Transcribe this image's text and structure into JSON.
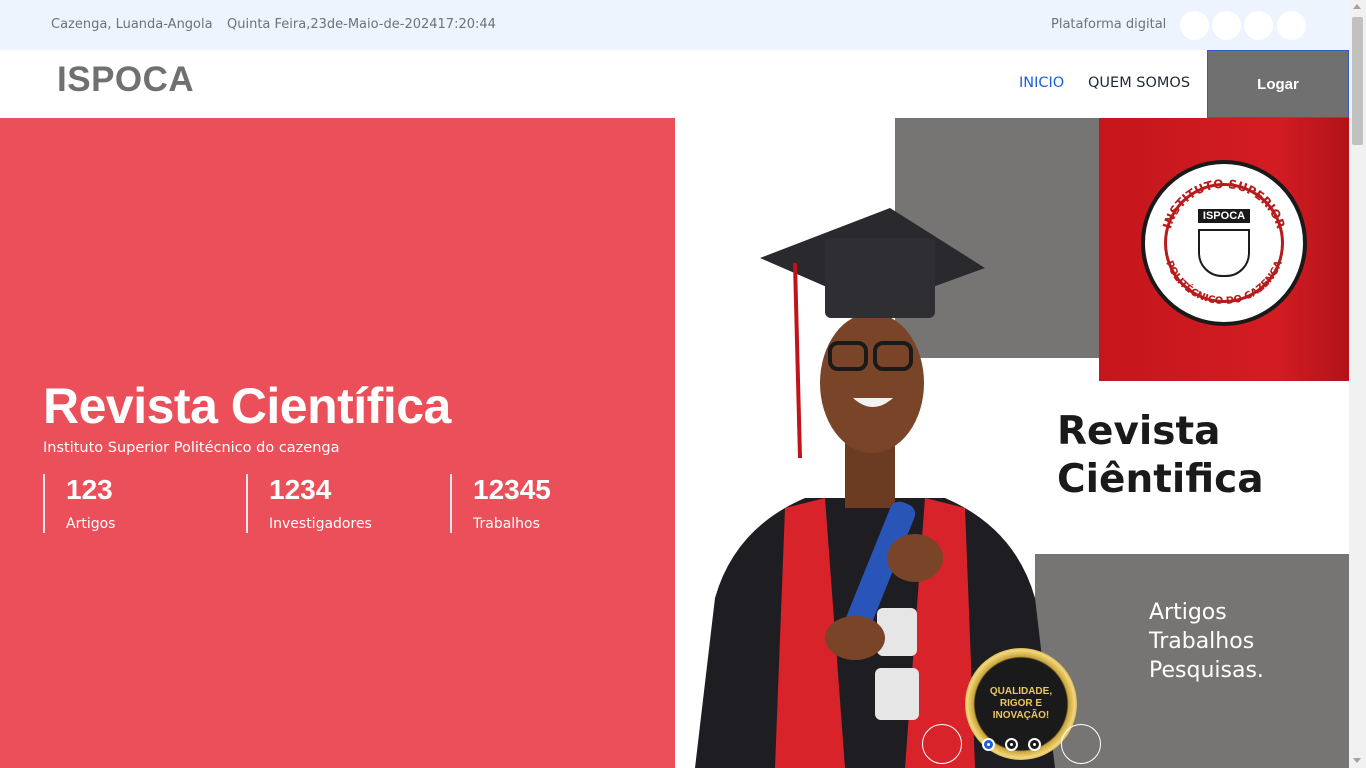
{
  "topbar": {
    "location": "Cazenga, Luanda-Angola",
    "datetime": "Quinta Feira,23de-Maio-de-202417:20:44",
    "platform": "Plataforma digital",
    "social_icons": [
      "social-icon-1",
      "social-icon-2",
      "social-icon-3",
      "social-icon-4"
    ]
  },
  "header": {
    "logo": "ISPOCA",
    "nav": [
      {
        "label": "INICIO",
        "active": true
      },
      {
        "label": "QUEM SOMOS",
        "active": false
      }
    ],
    "login_label": "Logar"
  },
  "hero": {
    "title": "Revista Científica",
    "subtitle": "Instituto Superior Politécnico do cazenga",
    "stats": [
      {
        "value": "123",
        "label": "Artigos"
      },
      {
        "value": "1234",
        "label": "Investigadores"
      },
      {
        "value": "12345",
        "label": "Trabalhos"
      }
    ]
  },
  "poster": {
    "seal_text": "ISPOCA",
    "seal_ring_top": "INSTITUTO SUPERIOR",
    "seal_ring_bottom": "POLITÉCNICO DO CAZENGA",
    "title_line1": "Revista",
    "title_line2": "Ciêntifica",
    "lines": [
      "Artigos",
      "Trabalhos",
      "Pesquisas."
    ],
    "badge": "QUALIDADE, RIGOR E INOVAÇÃO!"
  },
  "carousel": {
    "slides": 3,
    "active_index": 0
  },
  "colors": {
    "hero_bg": "#eb505a",
    "topbar_bg": "#eef4fd",
    "nav_active": "#1e5fd6",
    "login_bg": "#707070"
  }
}
